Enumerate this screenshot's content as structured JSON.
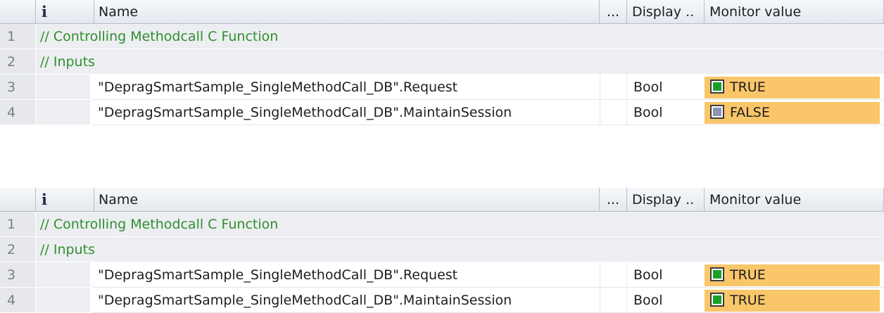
{
  "tables": [
    {
      "header": {
        "info": "i",
        "name": "Name",
        "dots": "...",
        "display": "Display ..",
        "monitor": "Monitor value"
      },
      "rows": [
        {
          "num": "1",
          "type": "comment",
          "text": "// Controlling Methodcall C Function"
        },
        {
          "num": "2",
          "type": "comment",
          "text": "// Inputs"
        },
        {
          "num": "3",
          "type": "var",
          "name": "\"DepragSmartSample_SingleMethodCall_DB\".Request",
          "display": "Bool",
          "value": "TRUE",
          "checked": true
        },
        {
          "num": "4",
          "type": "var",
          "name": "\"DepragSmartSample_SingleMethodCall_DB\".MaintainSession",
          "display": "Bool",
          "value": "FALSE",
          "checked": false
        }
      ]
    },
    {
      "header": {
        "info": "i",
        "name": "Name",
        "dots": "...",
        "display": "Display ..",
        "monitor": "Monitor value"
      },
      "rows": [
        {
          "num": "1",
          "type": "comment",
          "text": "// Controlling Methodcall C Function"
        },
        {
          "num": "2",
          "type": "comment",
          "text": "// Inputs"
        },
        {
          "num": "3",
          "type": "var",
          "name": "\"DepragSmartSample_SingleMethodCall_DB\".Request",
          "display": "Bool",
          "value": "TRUE",
          "checked": true
        },
        {
          "num": "4",
          "type": "var",
          "name": "\"DepragSmartSample_SingleMethodCall_DB\".MaintainSession",
          "display": "Bool",
          "value": "TRUE",
          "checked": true
        }
      ]
    }
  ],
  "colors": {
    "comment": "#2f8f2f",
    "monitor_bg": "#f9c66a",
    "true_fill": "#1aa02a",
    "false_fill": "#8e93b5"
  }
}
